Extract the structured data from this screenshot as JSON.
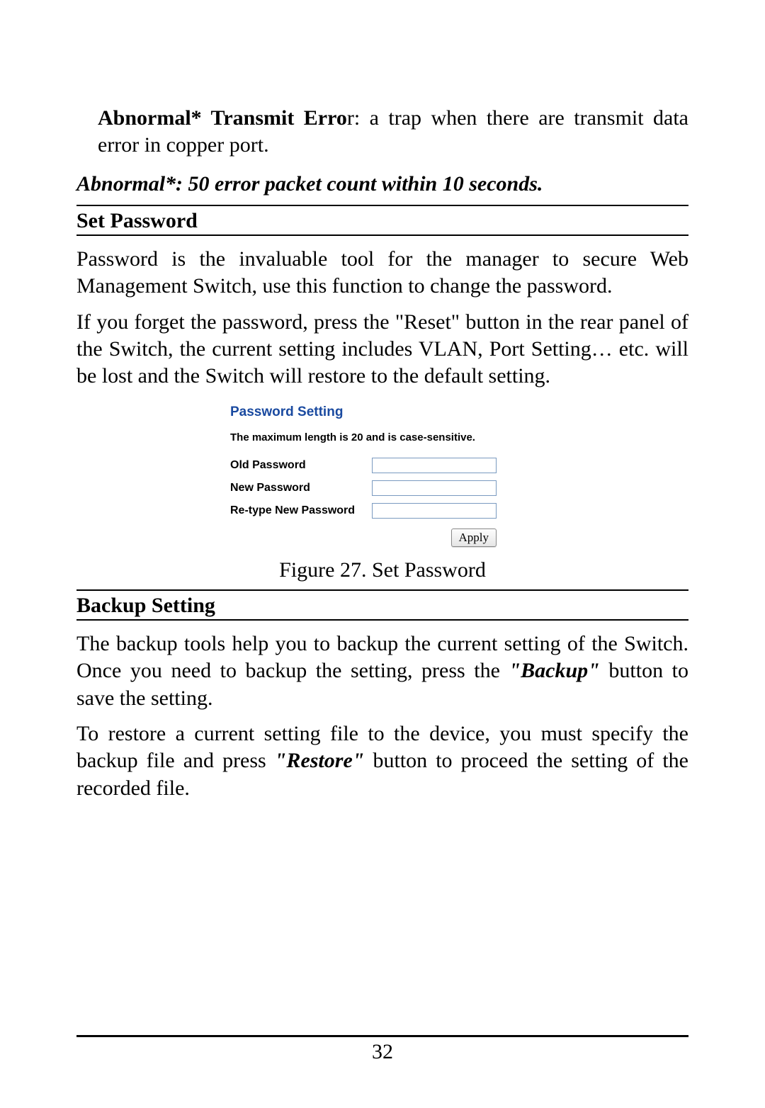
{
  "para1_prefix_bold": "Abnormal* Transmit Erro",
  "para1_rest": "r: a trap when there are transmit data error in copper port.",
  "abnormal_note": "Abnormal*: 50 error packet count within 10 seconds.",
  "section1": {
    "heading": "Set Password",
    "p1": "Password is the invaluable tool for the manager to secure Web Management Switch, use this function to change the password.",
    "p2": "If you forget the password, press the \"Reset\" button in the rear panel of the Switch, the current setting includes VLAN, Port Setting… etc. will be lost and the Switch will restore to the default setting."
  },
  "pw_widget": {
    "title": "Password Setting",
    "note": "The maximum length is 20 and is case-sensitive.",
    "old_label": "Old Password",
    "new_label": "New Password",
    "retype_label": "Re-type New Password",
    "apply": "Apply"
  },
  "figure_caption": "Figure 27. Set Password",
  "section2": {
    "heading": "Backup Setting",
    "p1a": "The backup tools help you to backup the current setting of the Switch. Once you need to backup the setting, press the ",
    "p1b_bold_italic": "\"Backup\"",
    "p1c": " button to save the setting.",
    "p2a": "To restore a current setting file to the device, you must specify the backup file and press ",
    "p2b_bold_italic": "\"Restore\"",
    "p2c": " button to proceed the setting of the recorded file."
  },
  "page_number": "32"
}
